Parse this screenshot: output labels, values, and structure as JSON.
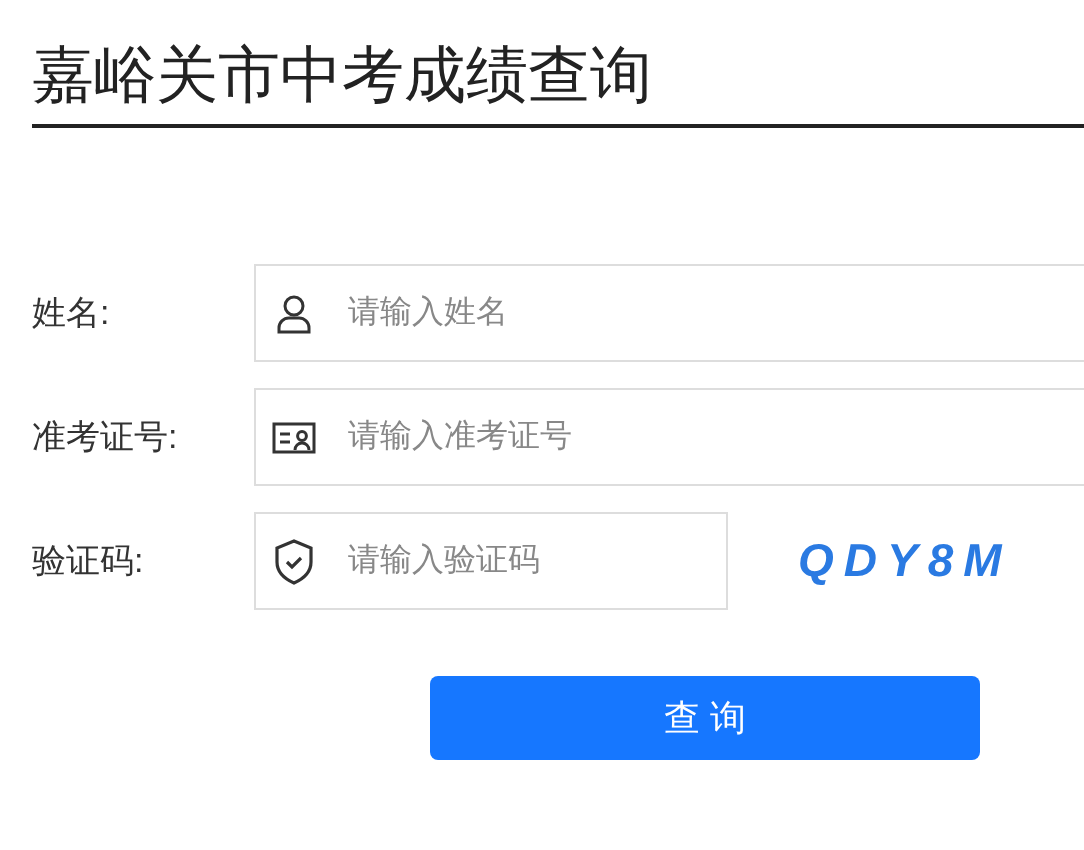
{
  "title": "嘉峪关市中考成绩查询",
  "fields": [
    {
      "label": "姓名:",
      "kind": "person",
      "placeholder": "请输入姓名"
    },
    {
      "label": "准考证号:",
      "kind": "id-card",
      "placeholder": "请输入准考证号"
    },
    {
      "label": "验证码:",
      "kind": "shield",
      "placeholder": "请输入验证码",
      "captcha": "QDY8M"
    }
  ],
  "submit": "查 询"
}
